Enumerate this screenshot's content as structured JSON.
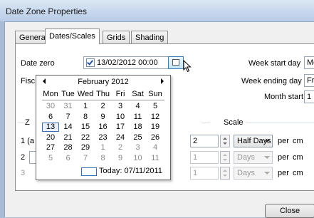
{
  "window": {
    "title": "Date Zone Properties"
  },
  "tabs": [
    {
      "label": "General"
    },
    {
      "label": "Dates/Scales"
    },
    {
      "label": "Grids"
    },
    {
      "label": "Shading"
    }
  ],
  "date_zero": {
    "label": "Date zero",
    "checked": true,
    "value": "13/02/2012 00:00"
  },
  "fiscal": {
    "label": "Fisc"
  },
  "week_start": {
    "label": "Week start day",
    "value": "Mo"
  },
  "week_end": {
    "label": "Week ending day",
    "value": "Fri"
  },
  "month_start": {
    "label": "Month start",
    "value": "1"
  },
  "zone_group": {
    "label": "Z"
  },
  "scale_group": {
    "label": "Scale"
  },
  "rows": [
    {
      "index": "1 (a",
      "spin_value": "2",
      "unit": "Half Days",
      "per": "per",
      "cm": "cm",
      "enabled": true
    },
    {
      "index": "2",
      "spin_value": "1",
      "unit": "Days",
      "per": "per",
      "cm": "cm",
      "enabled": false
    },
    {
      "index": "3",
      "spin_value": "1",
      "unit": "Days",
      "per": "per",
      "cm": "cm",
      "enabled": false
    }
  ],
  "calendar": {
    "month_title": "February 2012",
    "dow": [
      "Mon",
      "Tue",
      "Wed",
      "Thu",
      "Fri",
      "Sat",
      "Sun"
    ],
    "weeks": [
      [
        "30",
        "31",
        "1",
        "2",
        "3",
        "4",
        "5"
      ],
      [
        "6",
        "7",
        "8",
        "9",
        "10",
        "11",
        "12"
      ],
      [
        "13",
        "14",
        "15",
        "16",
        "17",
        "18",
        "19"
      ],
      [
        "20",
        "21",
        "22",
        "23",
        "24",
        "25",
        "26"
      ],
      [
        "27",
        "28",
        "29",
        "1",
        "2",
        "3",
        "4"
      ],
      [
        "5",
        "6",
        "7",
        "8",
        "9",
        "10",
        "11"
      ]
    ],
    "other_month": [
      [
        1,
        1,
        0,
        0,
        0,
        0,
        0
      ],
      [
        0,
        0,
        0,
        0,
        0,
        0,
        0
      ],
      [
        0,
        0,
        0,
        0,
        0,
        0,
        0
      ],
      [
        0,
        0,
        0,
        0,
        0,
        0,
        0
      ],
      [
        0,
        0,
        0,
        1,
        1,
        1,
        1
      ],
      [
        1,
        1,
        1,
        1,
        1,
        1,
        1
      ]
    ],
    "selected": "13",
    "today_label": "Today: 07/11/2011"
  },
  "buttons": {
    "close": "Close"
  },
  "icons": {
    "calendar_button": "calendar-icon",
    "prev": "chevron-left-icon",
    "next": "chevron-right-icon"
  }
}
